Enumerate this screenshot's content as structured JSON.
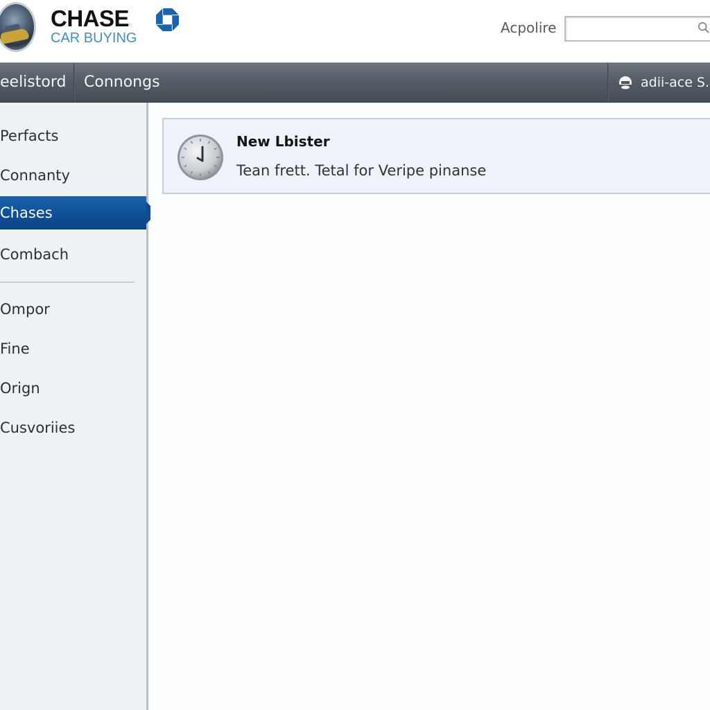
{
  "header": {
    "brand_name": "CHASE",
    "brand_reg": ".",
    "brand_sub": "CAR BUYING",
    "brand_color": "#1a63ad",
    "sub_color": "#3f8fc6",
    "search": {
      "label": "Acpolire",
      "value": "",
      "placeholder": "",
      "icon": "search-icon"
    }
  },
  "navbar": {
    "items": [
      {
        "label": "eelistord"
      },
      {
        "label": "Connongs"
      }
    ],
    "user": {
      "icon": "user-icon",
      "label": "adii-ace S..."
    }
  },
  "sidebar": {
    "items": [
      {
        "label": "Perfacts",
        "active": false
      },
      {
        "label": "Connanty",
        "active": false
      },
      {
        "label": "Chases",
        "active": true
      },
      {
        "label": "Combach",
        "active": false
      },
      {
        "label": "Ompor",
        "active": false
      },
      {
        "label": "Fine",
        "active": false
      },
      {
        "label": "Orign",
        "active": false
      },
      {
        "label": "Cusvoriies",
        "active": false
      }
    ],
    "active_color": "#0f4f96"
  },
  "main": {
    "notice": {
      "icon": "clock-icon",
      "title": "New Lbister",
      "body": "Tean frett. Tetal for Veripe pinanse"
    }
  }
}
